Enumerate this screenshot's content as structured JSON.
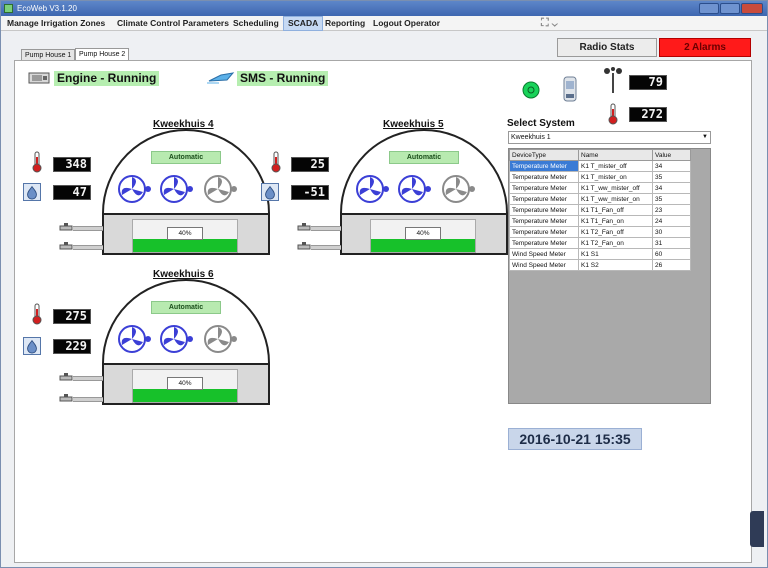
{
  "window": {
    "title": "EcoWeb V3.1.20"
  },
  "menu": [
    "Manage Irrigation Zones",
    "Climate Control Parameters",
    "Scheduling",
    "SCADA",
    "Reporting",
    "Logout Operator"
  ],
  "tabs": [
    "Pump House 1",
    "Pump House 2"
  ],
  "buttons": {
    "radio_stats": "Radio Stats",
    "alarm": "2 Alarms"
  },
  "status": {
    "engine": "Engine - Running",
    "sms": "SMS - Running"
  },
  "houses": [
    {
      "title": "Kweekhuis 4",
      "mode": "Automatic",
      "temp": "348",
      "humidity": "47",
      "tank": "40%"
    },
    {
      "title": "Kweekhuis 5",
      "mode": "Automatic",
      "temp": "25",
      "humidity": "-51",
      "tank": "40%"
    },
    {
      "title": "Kweekhuis 6",
      "mode": "Automatic",
      "temp": "275",
      "humidity": "229",
      "tank": "40%"
    }
  ],
  "weather": {
    "wind": "79",
    "direction": "272"
  },
  "select": {
    "label": "Select System",
    "value": "Kweekhuis 1"
  },
  "table": {
    "headers": [
      "DeviceType",
      "Name",
      "Value"
    ],
    "rows": [
      [
        "Temperature Meter",
        "K1 T_mister_off",
        "34"
      ],
      [
        "Temperature Meter",
        "K1 T_mister_on",
        "35"
      ],
      [
        "Temperature Meter",
        "K1 T_ww_mister_off",
        "34"
      ],
      [
        "Temperature Meter",
        "K1 T_ww_mister_on",
        "35"
      ],
      [
        "Temperature Meter",
        "K1 T1_Fan_off",
        "23"
      ],
      [
        "Temperature Meter",
        "K1 T1_Fan_on",
        "24"
      ],
      [
        "Temperature Meter",
        "K1 T2_Fan_off",
        "30"
      ],
      [
        "Temperature Meter",
        "K1 T2_Fan_on",
        "31"
      ],
      [
        "Wind Speed Meter",
        "K1 S1",
        "60"
      ],
      [
        "Wind Speed Meter",
        "K1 S2",
        "26"
      ]
    ]
  },
  "datetime": "2016-10-21 15:35",
  "colors": {
    "alarm": "#ff1a1a",
    "running": "#b6eeb0",
    "water": "#17c12a",
    "fan_active": "#3b3fd6",
    "fan_idle": "#8a8a8a"
  }
}
